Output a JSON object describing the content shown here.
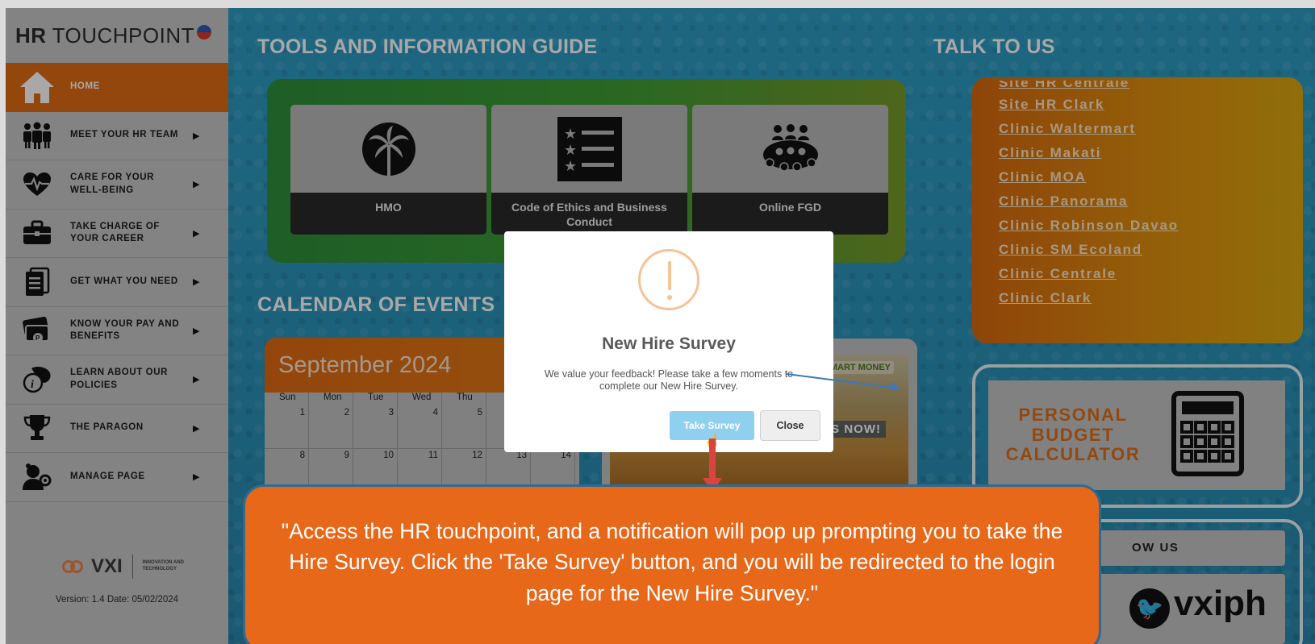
{
  "sidebar": {
    "brand_bold": "HR",
    "brand_rest": "TOUCHPOINT",
    "items": [
      {
        "label": "HOME",
        "active": true
      },
      {
        "label": "MEET YOUR HR TEAM"
      },
      {
        "label": "CARE FOR YOUR WELL-BEING"
      },
      {
        "label": "TAKE CHARGE OF YOUR CAREER"
      },
      {
        "label": "GET WHAT YOU NEED"
      },
      {
        "label": "KNOW YOUR PAY AND BENEFITS"
      },
      {
        "label": "LEARN ABOUT OUR POLICIES"
      },
      {
        "label": "THE PARAGON"
      },
      {
        "label": "MANAGE PAGE"
      }
    ],
    "logo_word": "VXI",
    "logo_tag": "INNOVATION AND TECHNOLOGY",
    "version": "Version: 1.4 Date: 05/02/2024"
  },
  "tools": {
    "title": "TOOLS AND INFORMATION GUIDE",
    "cards": [
      {
        "label": "HMO",
        "icon": "palm-tree-icon"
      },
      {
        "label": "Code of Ethics and Business Conduct",
        "icon": "star-checklist-icon"
      },
      {
        "label": "Online FGD",
        "icon": "group-meeting-icon"
      }
    ]
  },
  "talk": {
    "title": "TALK TO US",
    "links": [
      "Site HR Centrale",
      "Site HR Clark",
      "Clinic Waltermart",
      "Clinic Makati",
      "Clinic MOA",
      "Clinic Panorama",
      "Clinic Robinson Davao",
      "Clinic SM Ecoland",
      "Clinic Centrale",
      "Clinic Clark"
    ]
  },
  "budget": {
    "label": "PERSONAL BUDGET CALCULATOR",
    "icon": "calculator-icon"
  },
  "follow": {
    "label": "OW US",
    "handle": "vxiph",
    "icon": "twitter-bird-icon"
  },
  "calendar": {
    "title": "CALENDAR OF EVENTS",
    "month": "September 2024",
    "days": [
      "Sun",
      "Mon",
      "Tue",
      "Wed",
      "Thu"
    ],
    "week1": [
      "1",
      "2",
      "3",
      "4",
      "5"
    ],
    "week2": [
      "8",
      "9",
      "10",
      "11",
      "12",
      "13",
      "14"
    ]
  },
  "promo": {
    "badge": "SMART MONEY",
    "text": "BITS NOW!"
  },
  "modal": {
    "title": "New Hire Survey",
    "message": "We value your feedback! Please take a few moments to complete our New Hire Survey.",
    "take_label": "Take Survey",
    "close_label": "Close"
  },
  "callout": {
    "text": "\"Access the HR touchpoint, and a notification will pop up prompting you to take the Hire Survey. Click the 'Take Survey' button, and you will be redirected to the login page for the New Hire Survey.\""
  },
  "colors": {
    "accent_orange": "#e06c15",
    "sidebar_bg": "#c7c7c7",
    "main_blue": "#2a91b7",
    "tools_green": "#3f9e35",
    "survey_button": "#8fd0ee",
    "callout_border": "#2f6a93"
  }
}
